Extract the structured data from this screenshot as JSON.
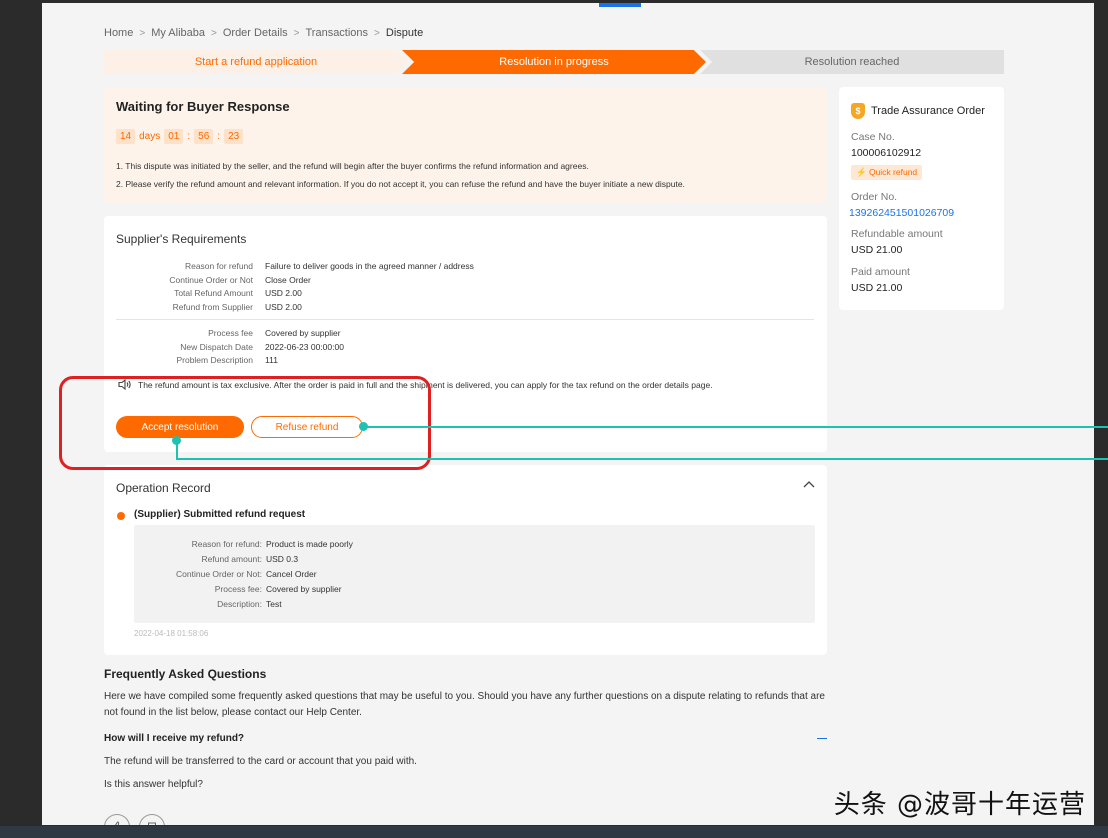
{
  "breadcrumb": [
    "Home",
    "My Alibaba",
    "Order Details",
    "Transactions",
    "Dispute"
  ],
  "breadcrumb_sep": ">",
  "steps": [
    "Start a refund application",
    "Resolution in progress",
    "Resolution reached"
  ],
  "waiting": {
    "title": "Waiting for Buyer Response",
    "countdown": {
      "days": "14",
      "days_label": "days",
      "hours": "01",
      "minutes": "56",
      "seconds": "23",
      "sep": ":"
    },
    "line1": "1. This dispute was initiated by the seller, and the refund will begin after the buyer confirms the refund information and agrees.",
    "line2": "2. Please verify the refund amount and relevant information. If you do not accept it, you can refuse the refund and have the buyer initiate a new dispute."
  },
  "side": {
    "title": "Trade Assurance Order",
    "shield_glyph": "$",
    "case_label": "Case No.",
    "case_value": "100006102912",
    "quick_refund": "Quick refund",
    "order_label": "Order No.",
    "order_value": "139262451501026709",
    "refundable_label": "Refundable amount",
    "refundable_value": "USD 21.00",
    "paid_label": "Paid amount",
    "paid_value": "USD 21.00"
  },
  "requirements": {
    "title": "Supplier's Requirements",
    "group1": [
      {
        "k": "Reason for refund",
        "v": "Failure to deliver goods in the agreed manner / address"
      },
      {
        "k": "Continue Order or Not",
        "v": "Close Order"
      },
      {
        "k": "Total Refund Amount",
        "v": "USD 2.00"
      },
      {
        "k": "Refund from Supplier",
        "v": "USD 2.00"
      }
    ],
    "group2": [
      {
        "k": "Process fee",
        "v": "Covered by supplier"
      },
      {
        "k": "New Dispatch Date",
        "v": "2022-06-23 00:00:00"
      },
      {
        "k": "Problem Description",
        "v": "111"
      }
    ],
    "notice": "The refund amount is tax exclusive. After the order is paid in full and the shipment is delivered, you can apply for the tax refund on the order details page.",
    "accept_label": "Accept resolution",
    "refuse_label": "Refuse refund"
  },
  "operation": {
    "title": "Operation Record",
    "entry_title": "(Supplier) Submitted refund request",
    "rows": [
      {
        "k": "Reason for refund:",
        "v": "Product is made poorly"
      },
      {
        "k": "Refund amount:",
        "v": "USD 0.3"
      },
      {
        "k": "Continue Order or Not:",
        "v": "Cancel Order"
      },
      {
        "k": "Process fee:",
        "v": "Covered by supplier"
      },
      {
        "k": "Description:",
        "v": "Test"
      }
    ],
    "time": "2022-04-18 01:58:06"
  },
  "faq": {
    "title": "Frequently Asked Questions",
    "intro": "Here we have compiled some frequently asked questions that may be useful to you. Should you have any further questions on a dispute relating to refunds that are not found in the list below, please contact our Help Center.",
    "question": "How will I receive my refund?",
    "answer": "The refund will be transferred to the card or account that you paid with.",
    "helpful": "Is this answer helpful?"
  },
  "watermark": "头条 @波哥十年运营",
  "colors": {
    "accent": "#ff6a00",
    "annotation_box": "#e02020",
    "pointer_line": "#1ec2b0",
    "link": "#1a73e8"
  }
}
